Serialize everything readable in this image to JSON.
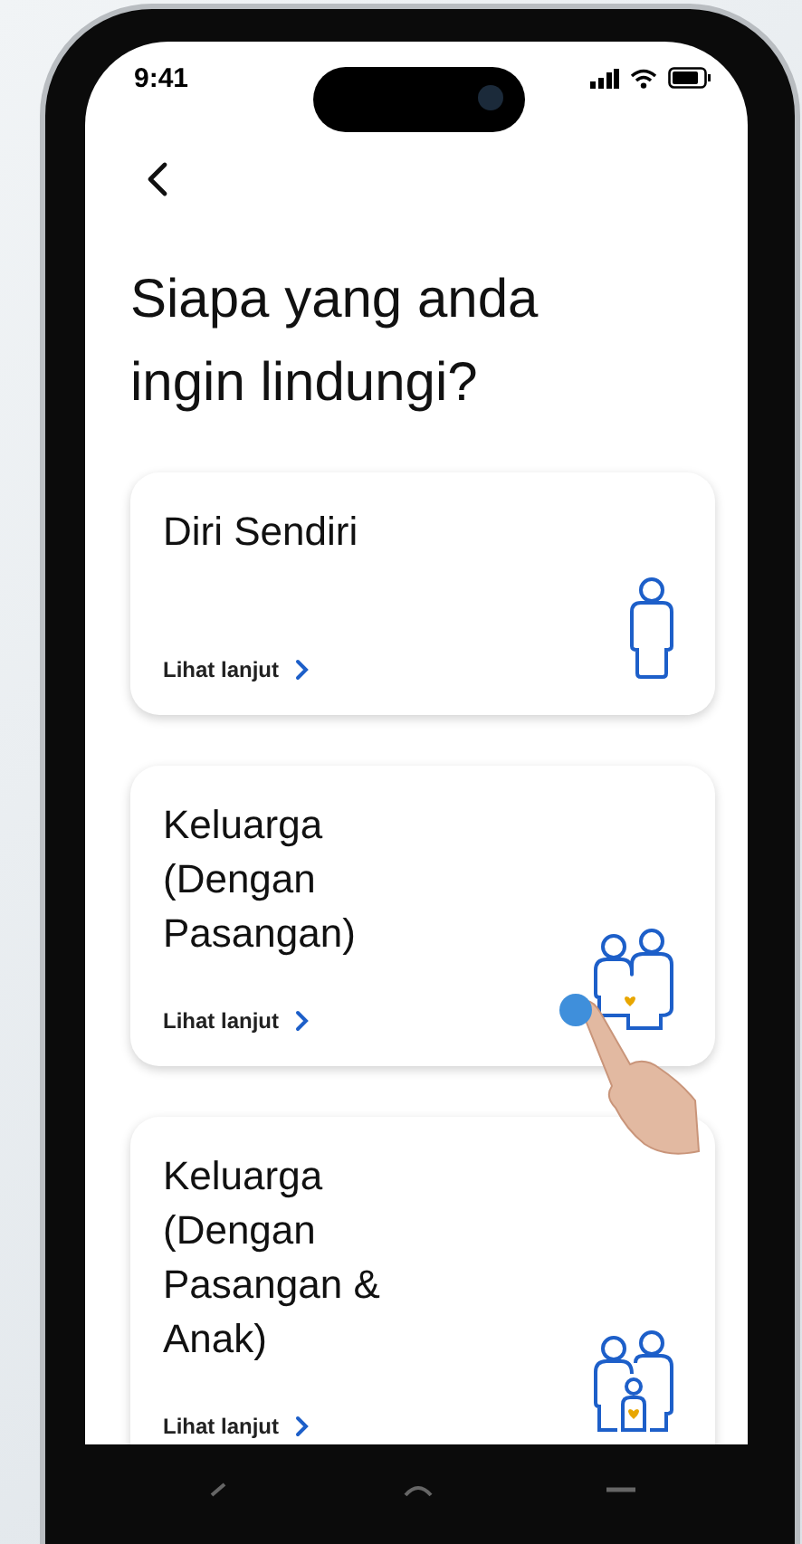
{
  "status_bar": {
    "time": "9:41"
  },
  "heading": "Siapa yang anda ingin lindungi?",
  "cards": [
    {
      "title": "Diri Sendiri",
      "link": "Lihat lanjut",
      "kind": "single"
    },
    {
      "title": "Keluarga (Dengan Pasangan)",
      "link": "Lihat lanjut",
      "kind": "couple"
    },
    {
      "title": "Keluarga (Dengan Pasangan & Anak)",
      "link": "Lihat lanjut",
      "kind": "family"
    }
  ]
}
